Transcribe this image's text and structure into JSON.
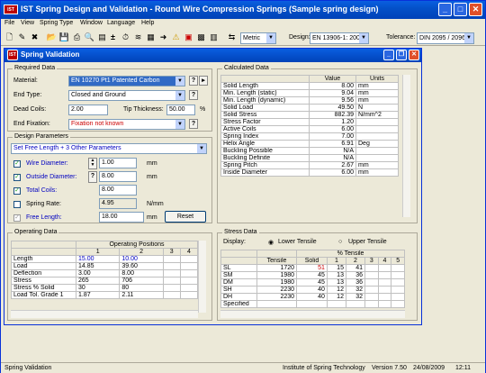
{
  "app": {
    "title": "IST Spring Design and Validation - Round Wire Compression Springs (Sample spring design)",
    "logo": "IST"
  },
  "menu": [
    "File",
    "View",
    "Spring Type",
    "Window",
    "Language",
    "Help"
  ],
  "toolbar": {
    "units": "Metric",
    "design_label": "Design:",
    "design_value": "EN 13906-1: 2002",
    "tolerance_label": "Tolerance:",
    "tolerance_value": "DIN 2095 / 2096"
  },
  "child": {
    "title": "Spring Validation"
  },
  "required": {
    "legend": "Required Data",
    "material_label": "Material:",
    "material_value": "EN 10270 Pt1 Patented Carbon",
    "endtype_label": "End Type:",
    "endtype_value": "Closed and Ground",
    "deadcoils_label": "Dead Coils:",
    "deadcoils_value": "2.00",
    "tip_label": "Tip Thickness:",
    "tip_value": "50.00",
    "tip_unit": "%",
    "endfix_label": "End Fixation:",
    "endfix_value": "Fixation not known"
  },
  "design": {
    "legend": "Design Parameters",
    "mode": "Set Free Length + 3 Other Parameters",
    "wire_label": "Wire Diameter:",
    "wire_value": "1.00",
    "wire_unit": "mm",
    "od_label": "Outside Diameter:",
    "od_value": "8.00",
    "od_unit": "mm",
    "coils_label": "Total Coils:",
    "coils_value": "8.00",
    "rate_label": "Spring Rate:",
    "rate_value": "4.95",
    "rate_unit": "N/mm",
    "free_label": "Free Length:",
    "free_value": "18.00",
    "free_unit": "mm",
    "reset": "Reset"
  },
  "operating": {
    "legend": "Operating Data",
    "header": "Operating Positions",
    "cols": [
      "1",
      "2",
      "3",
      "4"
    ],
    "rows": [
      {
        "label": "Length",
        "v": [
          "15.00",
          "10.00",
          "",
          ""
        ]
      },
      {
        "label": "Load",
        "v": [
          "14.85",
          "39.60",
          "",
          ""
        ]
      },
      {
        "label": "Deflection",
        "v": [
          "3.00",
          "8.00",
          "",
          ""
        ]
      },
      {
        "label": "Stress",
        "v": [
          "265",
          "706",
          "",
          ""
        ]
      },
      {
        "label": "Stress % Solid",
        "v": [
          "30",
          "80",
          "",
          ""
        ]
      },
      {
        "label": "Load Tol. Grade 1",
        "v": [
          "1.87",
          "2.11",
          "",
          ""
        ]
      }
    ]
  },
  "calculated": {
    "legend": "Calculated Data",
    "col_value": "Value",
    "col_units": "Units",
    "rows": [
      {
        "label": "Solid Length",
        "value": "8.00",
        "unit": "mm"
      },
      {
        "label": "Min. Length (static)",
        "value": "9.04",
        "unit": "mm"
      },
      {
        "label": "Min. Length (dynamic)",
        "value": "9.56",
        "unit": "mm"
      },
      {
        "label": "Solid Load",
        "value": "49.50",
        "unit": "N"
      },
      {
        "label": "Solid Stress",
        "value": "882.39",
        "unit": "N/mm^2"
      },
      {
        "label": "Stress Factor",
        "value": "1.20",
        "unit": ""
      },
      {
        "label": "Active Coils",
        "value": "6.00",
        "unit": ""
      },
      {
        "label": "Spring Index",
        "value": "7.00",
        "unit": ""
      },
      {
        "label": "Helix Angle",
        "value": "6.91",
        "unit": "Deg"
      },
      {
        "label": "Buckling Possible",
        "value": "N/A",
        "unit": ""
      },
      {
        "label": "Buckling Definite",
        "value": "N/A",
        "unit": ""
      },
      {
        "label": "Spring Pitch",
        "value": "2.67",
        "unit": "mm"
      },
      {
        "label": "Inside Diameter",
        "value": "6.00",
        "unit": "mm"
      }
    ]
  },
  "stress": {
    "legend": "Stress Data",
    "display_label": "Display:",
    "lower": "Lower Tensile",
    "upper": "Upper Tensile",
    "pct_header": "% Tensile",
    "cols": [
      "Tensile",
      "Solid",
      "1",
      "2",
      "3",
      "4",
      "5"
    ],
    "rows": [
      {
        "label": "SL",
        "v": [
          "1720",
          "51",
          "15",
          "41",
          "",
          "",
          ""
        ]
      },
      {
        "label": "SM",
        "v": [
          "1980",
          "45",
          "13",
          "36",
          "",
          "",
          ""
        ]
      },
      {
        "label": "DM",
        "v": [
          "1980",
          "45",
          "13",
          "36",
          "",
          "",
          ""
        ]
      },
      {
        "label": "SH",
        "v": [
          "2230",
          "40",
          "12",
          "32",
          "",
          "",
          ""
        ]
      },
      {
        "label": "DH",
        "v": [
          "2230",
          "40",
          "12",
          "32",
          "",
          "",
          ""
        ]
      },
      {
        "label": "Specified",
        "v": [
          "",
          "",
          "",
          "",
          "",
          "",
          ""
        ]
      }
    ]
  },
  "status": {
    "left": "Spring Validation",
    "org": "Institute of Spring Technology",
    "version": "Version 7.50",
    "date": "24/08/2009",
    "time": "12:11"
  }
}
